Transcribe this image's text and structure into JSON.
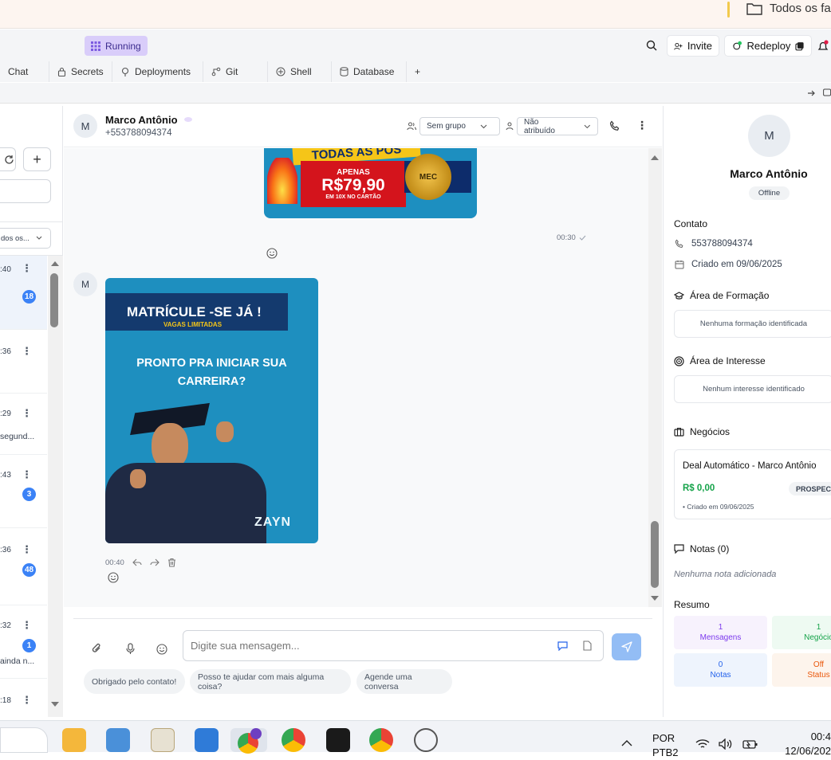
{
  "explorer": {
    "folder_label": "Todos os fa"
  },
  "replit": {
    "status": "Running",
    "invite_label": "Invite",
    "redeploy_label": "Redeploy",
    "tabs": [
      "Chat",
      "Secrets",
      "Deployments",
      "Git",
      "Shell",
      "Database"
    ],
    "add_tab": "+"
  },
  "sidebar": {
    "filter_value": "dos os...",
    "add_label": "+",
    "rows": [
      {
        "time": ":40",
        "badge": "18",
        "snippet": ""
      },
      {
        "time": ":36",
        "badge": "",
        "snippet": ""
      },
      {
        "time": ":29",
        "badge": "",
        "snippet": "segund..."
      },
      {
        "time": ":43",
        "badge": "3",
        "snippet": ""
      },
      {
        "time": ":36",
        "badge": "48",
        "snippet": ""
      },
      {
        "time": ":32",
        "badge": "1",
        "snippet": "ainda n..."
      },
      {
        "time": ":18",
        "badge": "",
        "snippet": ""
      }
    ]
  },
  "chat": {
    "contact_initial": "M",
    "contact_name": "Marco Antônio",
    "contact_phone": "+553788094374",
    "group_select": "Sem grupo",
    "assign_select": "Não atribuído",
    "banner_top": "TODAS AS PÓS",
    "banner_apenas": "APENAS",
    "banner_price": "R$79,90",
    "banner_installments": "EM 10X NO CARTÃO",
    "banner_seal": "MEC",
    "msg1_time": "00:30",
    "msg2_initial": "M",
    "poster_title": "MATRÍCULE -SE JÁ !",
    "poster_sub": "VAGAS LIMITADAS",
    "poster_line1": "PRONTO PRA INICIAR SUA",
    "poster_line2": "CARREIRA?",
    "poster_brand": "ZAYN",
    "msg2_time": "00:40",
    "input_placeholder": "Digite sua mensagem...",
    "quick_replies": [
      "Obrigado pelo contato!",
      "Posso te ajudar com mais alguma coisa?",
      "Agende uma conversa"
    ]
  },
  "contact_panel": {
    "initial": "M",
    "name": "Marco Antônio",
    "status": "Offline",
    "contato_title": "Contato",
    "phone": "553788094374",
    "created": "Criado em 09/06/2025",
    "formacao_title": "Área de Formação",
    "formacao_empty": "Nenhuma formação identificada",
    "interesse_title": "Área de Interesse",
    "interesse_empty": "Nenhum interesse identificado",
    "negocios_title": "Negócios",
    "deal_title": "Deal Automático - Marco Antônio",
    "deal_value": "R$ 0,00",
    "deal_stage": "PROSPECT",
    "deal_created": "• Criado em 09/06/2025",
    "notas_title": "Notas (0)",
    "notas_empty": "Nenhuma nota adicionada",
    "resumo_title": "Resumo",
    "stats": [
      {
        "value": "1",
        "label": "Mensagens",
        "color": "#7c3aed",
        "bg": "#f7f2fd"
      },
      {
        "value": "1",
        "label": "Negócio",
        "color": "#16a34a",
        "bg": "#eefaf2"
      },
      {
        "value": "0",
        "label": "Notas",
        "color": "#2563eb",
        "bg": "#eef4fd"
      },
      {
        "value": "Off",
        "label": "Status",
        "color": "#ea580c",
        "bg": "#fdf4ec"
      }
    ]
  },
  "taskbar": {
    "lang1": "POR",
    "lang2": "PTB2",
    "time": "00:4",
    "date": "12/06/202"
  }
}
